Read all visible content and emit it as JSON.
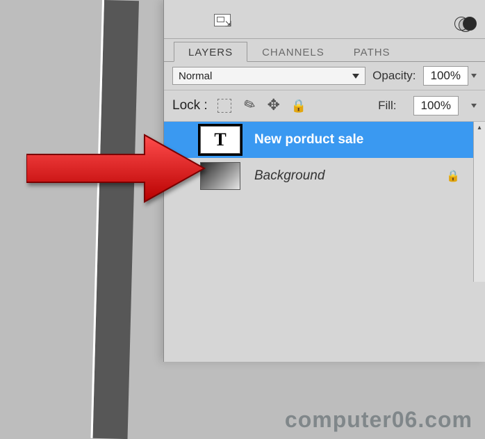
{
  "tabs": {
    "layers": "LAYERS",
    "channels": "CHANNELS",
    "paths": "PATHS"
  },
  "blend": {
    "mode": "Normal"
  },
  "opacity": {
    "label": "Opacity:",
    "value": "100%"
  },
  "lock": {
    "label": "Lock :"
  },
  "fill": {
    "label": "Fill:",
    "value": "100%"
  },
  "layers": [
    {
      "type": "text",
      "name": "New porduct sale",
      "selected": true
    },
    {
      "type": "background",
      "name": "Background",
      "locked": true
    }
  ],
  "watermark": "computer06.com"
}
